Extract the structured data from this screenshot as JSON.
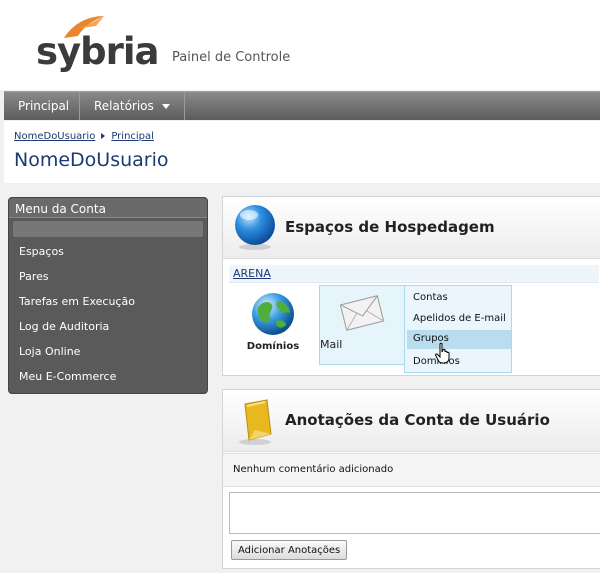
{
  "header": {
    "logo": "sybria",
    "subtitle": "Painel de Controle"
  },
  "nav": {
    "items": [
      {
        "label": "Principal"
      },
      {
        "label": "Relatórios"
      }
    ]
  },
  "breadcrumb": {
    "items": [
      "NomeDoUsuario",
      "Principal"
    ],
    "title": "NomeDoUsuario"
  },
  "sidebar": {
    "title": "Menu da Conta",
    "items": [
      "Espaços",
      "Pares",
      "Tarefas em Execução",
      "Log de Auditoria",
      "Loja Online",
      "Meu E-Commerce"
    ]
  },
  "hosting": {
    "title": "Espaços de Hospedagem",
    "space": "ARENA",
    "tiles": [
      {
        "label": "Domínios",
        "icon": "globe-icon"
      },
      {
        "label": "Mail",
        "icon": "envelope-icon"
      }
    ],
    "mail_menu": [
      "Contas",
      "Apelidos de E-mail",
      "Grupos",
      "Domínios"
    ]
  },
  "notes": {
    "title": "Anotações da Conta de Usuário",
    "empty_text": "Nenhum comentário adicionado",
    "add_button": "Adicionar Anotações"
  },
  "colors": {
    "brand_orange": "#e8862b",
    "link_blue": "#1c3a73",
    "nav_gray": "#6b6b6b",
    "highlight_blue": "#b9dcef"
  }
}
